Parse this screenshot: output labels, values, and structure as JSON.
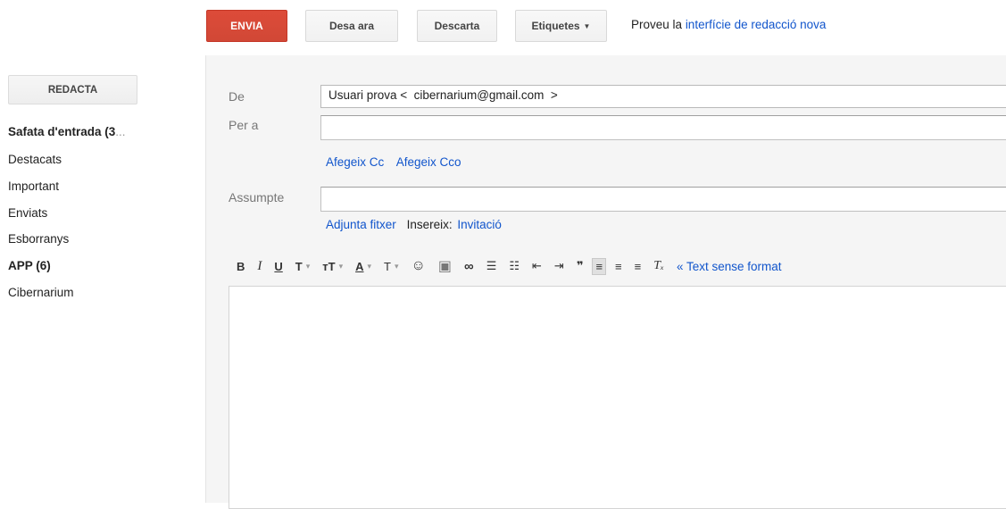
{
  "toolbar": {
    "send": "ENVIA",
    "save": "Desa ara",
    "discard": "Descarta",
    "labels": "Etiquetes",
    "labels_caret": "▼",
    "try_text": "Proveu la",
    "try_link": "interfície de redacció nova"
  },
  "nav": {
    "compose": "REDACTA",
    "inbox": "Safata d'entrada (3",
    "inbox_more": "...",
    "starred": "Destacats",
    "important": "Important",
    "sent": "Enviats",
    "drafts": "Esborranys",
    "app": "APP (6)",
    "cibernarium": "Cibernarium"
  },
  "compose": {
    "from_label": "De",
    "from_value": "Usuari prova <  cibernarium@gmail.com  >",
    "to_label": "Per a",
    "add_cc": "Afegeix Cc",
    "add_bcc": "Afegeix Cco",
    "subject_label": "Assumpte",
    "attach": "Adjunta fitxer",
    "insert": "Insereix:",
    "invite": "Invitació",
    "plain_text": "« Text sense format"
  },
  "format": {
    "bold": "B",
    "italic": "I",
    "underline": "U",
    "font": "T",
    "size": "ᴛT",
    "text_color": "A",
    "bg_color": "T",
    "emoji": "☺",
    "image": "▣",
    "link": "∞",
    "numbered": "☰",
    "bulleted": "☷",
    "indent_less": "⇤",
    "indent_more": "⇥",
    "quote": "❞",
    "align_left": "≡",
    "align_center": "≡",
    "align_right": "≡",
    "clear": "Tₓ",
    "dropdown": "▾"
  }
}
